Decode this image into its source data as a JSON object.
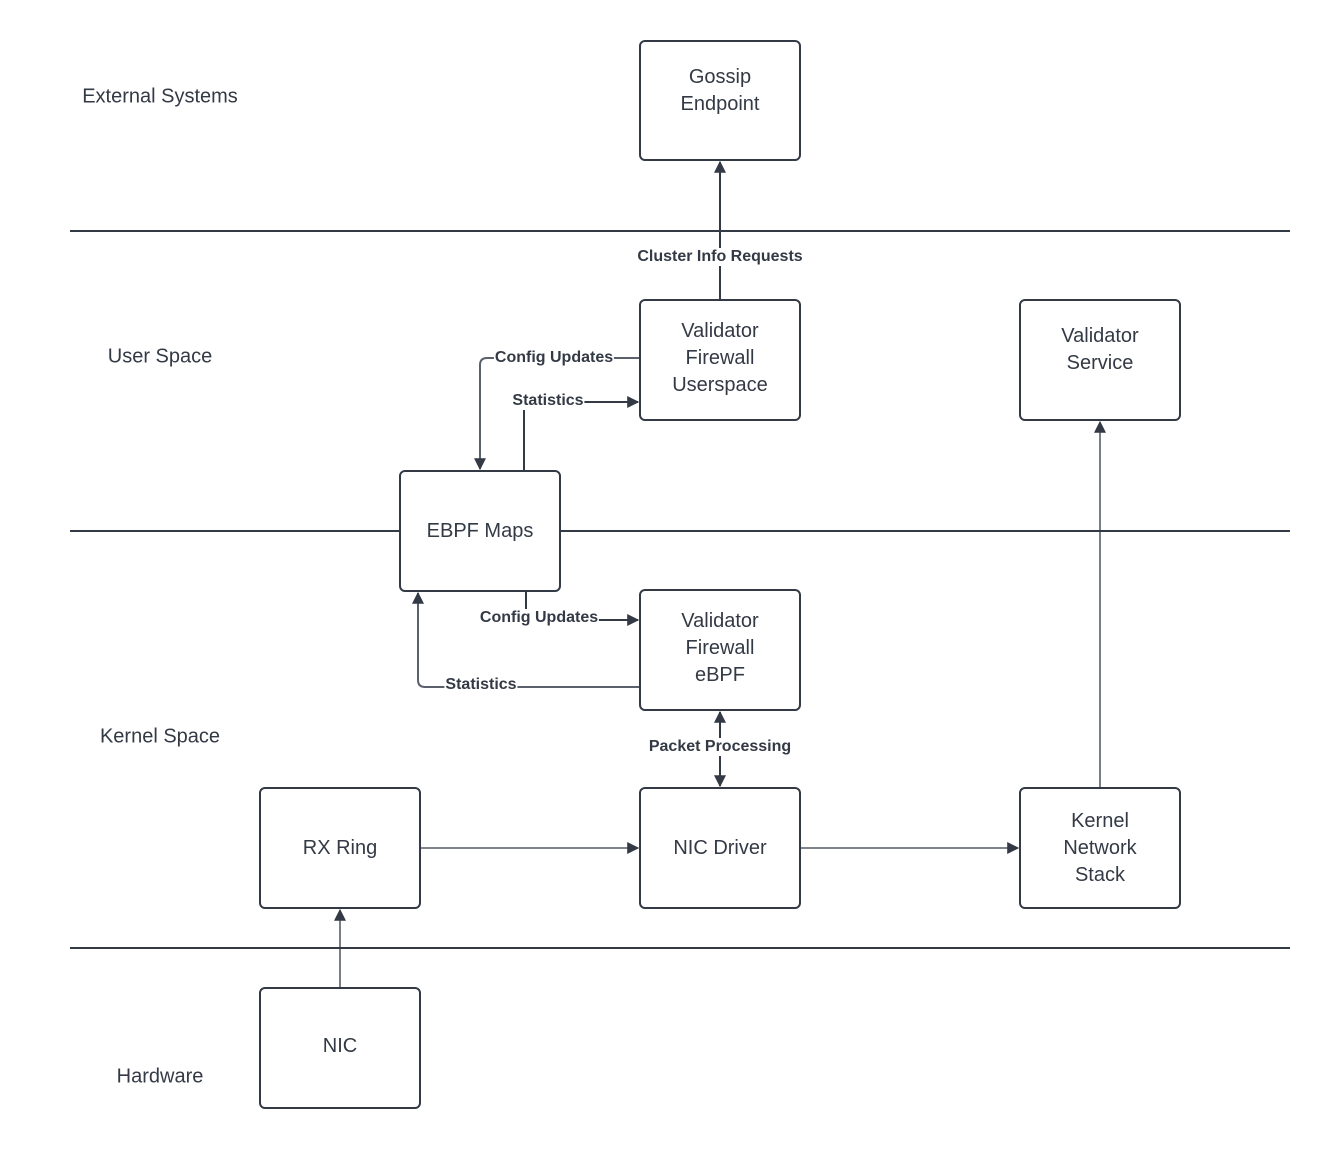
{
  "diagram": {
    "title": "",
    "colors": {
      "stroke": "#333a45",
      "connector_light": "#5b616c",
      "background": "#ffffff"
    },
    "lanes": [
      {
        "id": "external",
        "label": "External Systems"
      },
      {
        "id": "user",
        "label": "User Space"
      },
      {
        "id": "kernel",
        "label": "Kernel Space"
      },
      {
        "id": "hardware",
        "label": "Hardware"
      }
    ],
    "nodes": [
      {
        "id": "gossip",
        "label": "Gossip\nEndpoint",
        "lane": "external"
      },
      {
        "id": "fw_user",
        "label": "Validator\nFirewall\nUserspace",
        "lane": "user"
      },
      {
        "id": "validator_service",
        "label": "Validator\nService",
        "lane": "user"
      },
      {
        "id": "ebpf_maps",
        "label": "EBPF Maps",
        "lane": "user/kernel boundary"
      },
      {
        "id": "fw_ebpf",
        "label": "Validator\nFirewall\neBPF",
        "lane": "kernel"
      },
      {
        "id": "rx_ring",
        "label": "RX Ring",
        "lane": "kernel"
      },
      {
        "id": "nic_driver",
        "label": "NIC Driver",
        "lane": "kernel"
      },
      {
        "id": "kernel_stack",
        "label": "Kernel\nNetwork\nStack",
        "lane": "kernel"
      },
      {
        "id": "nic",
        "label": "NIC",
        "lane": "hardware"
      }
    ],
    "edges": [
      {
        "from": "fw_user",
        "to": "gossip",
        "label": "Cluster Info Requests",
        "direction": "forward"
      },
      {
        "from": "fw_user",
        "to": "ebpf_maps",
        "label": "Config Updates",
        "direction": "forward"
      },
      {
        "from": "ebpf_maps",
        "to": "fw_user",
        "label": "Statistics",
        "direction": "forward"
      },
      {
        "from": "ebpf_maps",
        "to": "fw_ebpf",
        "label": "Config Updates",
        "direction": "forward"
      },
      {
        "from": "fw_ebpf",
        "to": "ebpf_maps",
        "label": "Statistics",
        "direction": "forward"
      },
      {
        "from": "fw_ebpf",
        "to": "nic_driver",
        "label": "Packet Processing",
        "direction": "both"
      },
      {
        "from": "nic",
        "to": "rx_ring",
        "label": "",
        "direction": "forward"
      },
      {
        "from": "rx_ring",
        "to": "nic_driver",
        "label": "",
        "direction": "forward"
      },
      {
        "from": "nic_driver",
        "to": "kernel_stack",
        "label": "",
        "direction": "forward"
      },
      {
        "from": "kernel_stack",
        "to": "validator_service",
        "label": "",
        "direction": "forward"
      }
    ]
  }
}
